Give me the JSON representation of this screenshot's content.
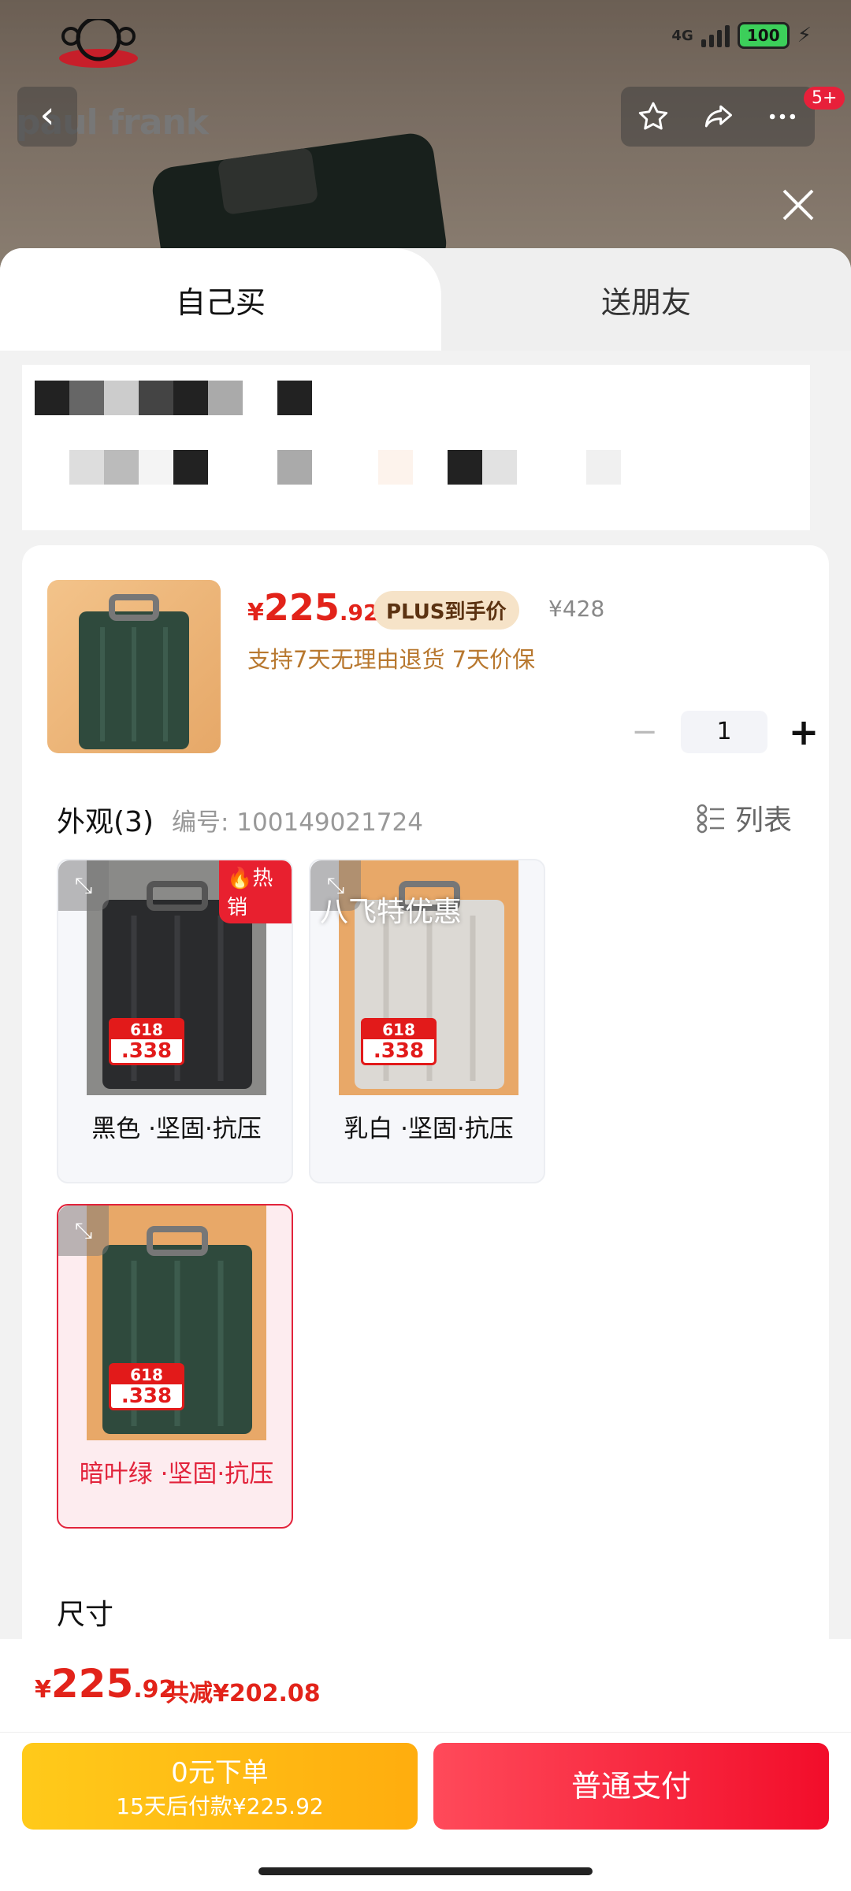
{
  "status": {
    "network": "4G",
    "battery": "100"
  },
  "brand": {
    "logo_text": "paul frank"
  },
  "header": {
    "notification_badge": "5+"
  },
  "tabs": {
    "self": "自己买",
    "gift": "送朋友"
  },
  "product": {
    "price": {
      "symbol": "¥",
      "integer": "225",
      "decimal": ".92"
    },
    "plus_tag": "PLUS到手价",
    "original_price": "¥428",
    "policy": "支持7天无理由退货  7天价保",
    "quantity": "1"
  },
  "appearance": {
    "title": "外观(3)",
    "code": "编号: 100149021724",
    "view_toggle": "列表",
    "hot_badge": "热销",
    "overlay_promo": "八飞特优惠",
    "options": [
      {
        "label": "黑色 ·坚固·抗压",
        "color": "#2a2b2d"
      },
      {
        "label": "乳白 ·坚固·抗压",
        "color": "#dcd9d4"
      },
      {
        "label": "暗叶绿 ·坚固·抗压",
        "color": "#2f4a3d"
      }
    ],
    "promo_tag": {
      "event": "618",
      "price": ".338"
    }
  },
  "size": {
    "title": "尺寸"
  },
  "footer": {
    "total": {
      "symbol": "¥",
      "integer": "225",
      "decimal": ".92"
    },
    "saving": "共减¥202.08",
    "pay_later": {
      "line1": "0元下单",
      "line2": "15天后付款¥225.92"
    },
    "pay_now": "普通支付"
  },
  "colors": {
    "accent": "#e2231a",
    "plus_gold": "#f6e3c8",
    "pay_red": "#f20d2a",
    "pay_yellow": "#ffb80f"
  }
}
